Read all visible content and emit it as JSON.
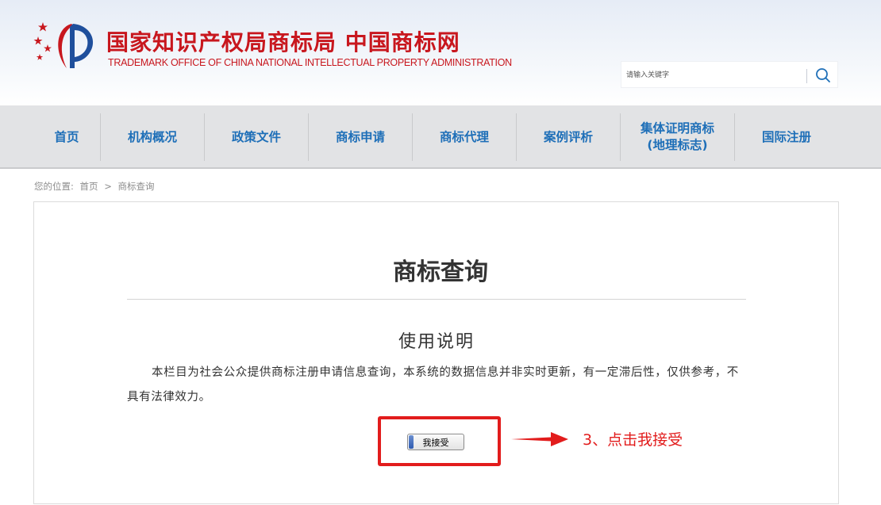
{
  "header": {
    "title": "国家知识产权局商标局 中国商标网",
    "subtitle": "TRADEMARK OFFICE OF CHINA NATIONAL INTELLECTUAL PROPERTY ADMINISTRATION"
  },
  "search": {
    "placeholder": "请输入关键字"
  },
  "nav": {
    "items": [
      {
        "label": "首页"
      },
      {
        "label": "机构概况"
      },
      {
        "label": "政策文件"
      },
      {
        "label": "商标申请"
      },
      {
        "label": "商标代理"
      },
      {
        "label": "案例评析"
      },
      {
        "label_line1": "集体证明商标",
        "label_line2": "(地理标志)"
      },
      {
        "label": "国际注册"
      }
    ]
  },
  "breadcrumb": {
    "prefix": "您的位置:",
    "home": "首页",
    "separator": ">",
    "current": "商标查询"
  },
  "content": {
    "title": "商标查询",
    "section_title": "使用说明",
    "notice": "本栏目为社会公众提供商标注册申请信息查询，本系统的数据信息并非实时更新，有一定滞后性，仅供参考，不具有法律效力。",
    "accept_label": "我接受"
  },
  "annotation": {
    "step_text": "3、点击我接受",
    "color": "#e21c1c"
  },
  "colors": {
    "brand_red": "#c8171e",
    "nav_blue": "#1e6fb8"
  }
}
